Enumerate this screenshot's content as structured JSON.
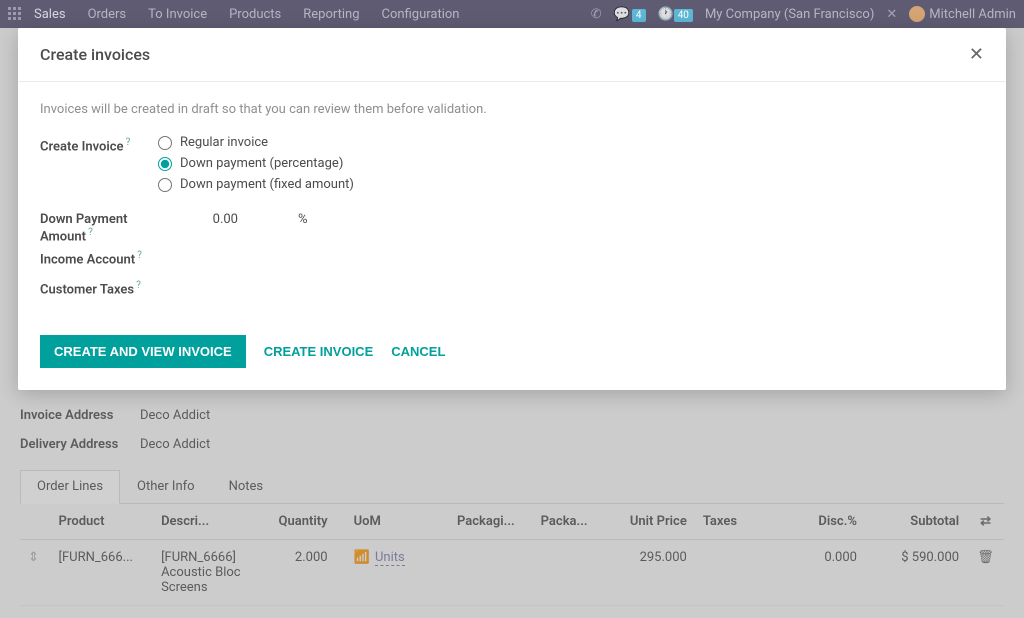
{
  "topnav": {
    "app": "Sales",
    "menu": [
      "Orders",
      "To Invoice",
      "Products",
      "Reporting",
      "Configuration"
    ],
    "chat_badge": "4",
    "activity_badge": "40",
    "company": "My Company (San Francisco)",
    "user": "Mitchell Admin"
  },
  "modal": {
    "title": "Create invoices",
    "help": "Invoices will be created in draft so that you can review them before validation.",
    "create_invoice_label": "Create Invoice",
    "radios": {
      "regular": "Regular invoice",
      "down_pct": "Down payment (percentage)",
      "down_fixed": "Down payment (fixed amount)"
    },
    "down_payment_label": "Down Payment Amount",
    "down_payment_value": "0.00",
    "down_payment_unit": "%",
    "income_account_label": "Income Account",
    "customer_taxes_label": "Customer Taxes",
    "btn_primary": "Create and View Invoice",
    "btn_create": "Create Invoice",
    "btn_cancel": "Cancel"
  },
  "page": {
    "invoice_address_label": "Invoice Address",
    "invoice_address_value": "Deco Addict",
    "delivery_address_label": "Delivery Address",
    "delivery_address_value": "Deco Addict",
    "tabs": [
      "Order Lines",
      "Other Info",
      "Notes"
    ],
    "columns": {
      "product": "Product",
      "description": "Descri...",
      "quantity": "Quantity",
      "uom": "UoM",
      "packaging": "Packagi...",
      "packa": "Packa...",
      "unit_price": "Unit Price",
      "taxes": "Taxes",
      "disc": "Disc.%",
      "subtotal": "Subtotal"
    },
    "row": {
      "product": "[FURN_666...",
      "description": "[FURN_6666] Acoustic Bloc Screens",
      "quantity": "2.000",
      "uom": "Units",
      "unit_price": "295.000",
      "disc": "0.000",
      "subtotal": "$ 590.000"
    }
  }
}
